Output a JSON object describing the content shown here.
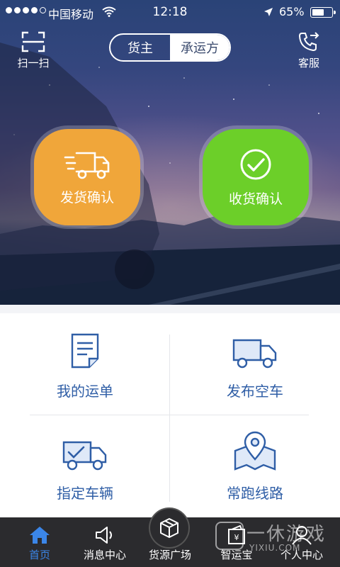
{
  "status_bar": {
    "signal_dots_filled": 4,
    "signal_dots_total": 5,
    "carrier": "中国移动",
    "time": "12:18",
    "battery_percent": "65%",
    "battery_level": 0.65
  },
  "header": {
    "scan_label": "扫一扫",
    "service_label": "客服",
    "role_toggle": {
      "selected": "货主",
      "other": "承运方"
    }
  },
  "hero_actions": {
    "ship_confirm_label": "发货确认",
    "receive_confirm_label": "收货确认",
    "colors": {
      "ship": "#f0a63a",
      "receive": "#6ccf29"
    }
  },
  "grid": {
    "items": [
      {
        "label": "我的运单",
        "icon": "document-icon"
      },
      {
        "label": "发布空车",
        "icon": "empty-truck-icon"
      },
      {
        "label": "指定车辆",
        "icon": "checked-truck-icon"
      },
      {
        "label": "常跑线路",
        "icon": "map-location-icon"
      }
    ],
    "label_color": "#2f5ea6"
  },
  "tabbar": {
    "tabs": [
      {
        "label": "首页",
        "icon": "home-icon",
        "active": true
      },
      {
        "label": "消息中心",
        "icon": "speaker-icon",
        "active": false
      },
      {
        "label": "货源广场",
        "icon": "cube-icon",
        "active": false
      },
      {
        "label": "智运宝",
        "icon": "wallet-icon",
        "active": false
      },
      {
        "label": "个人中心",
        "icon": "person-icon",
        "active": false
      }
    ],
    "active_color": "#3b86e8"
  },
  "watermark": {
    "title": "一休游戏",
    "domain": "YIXIU.COM"
  }
}
